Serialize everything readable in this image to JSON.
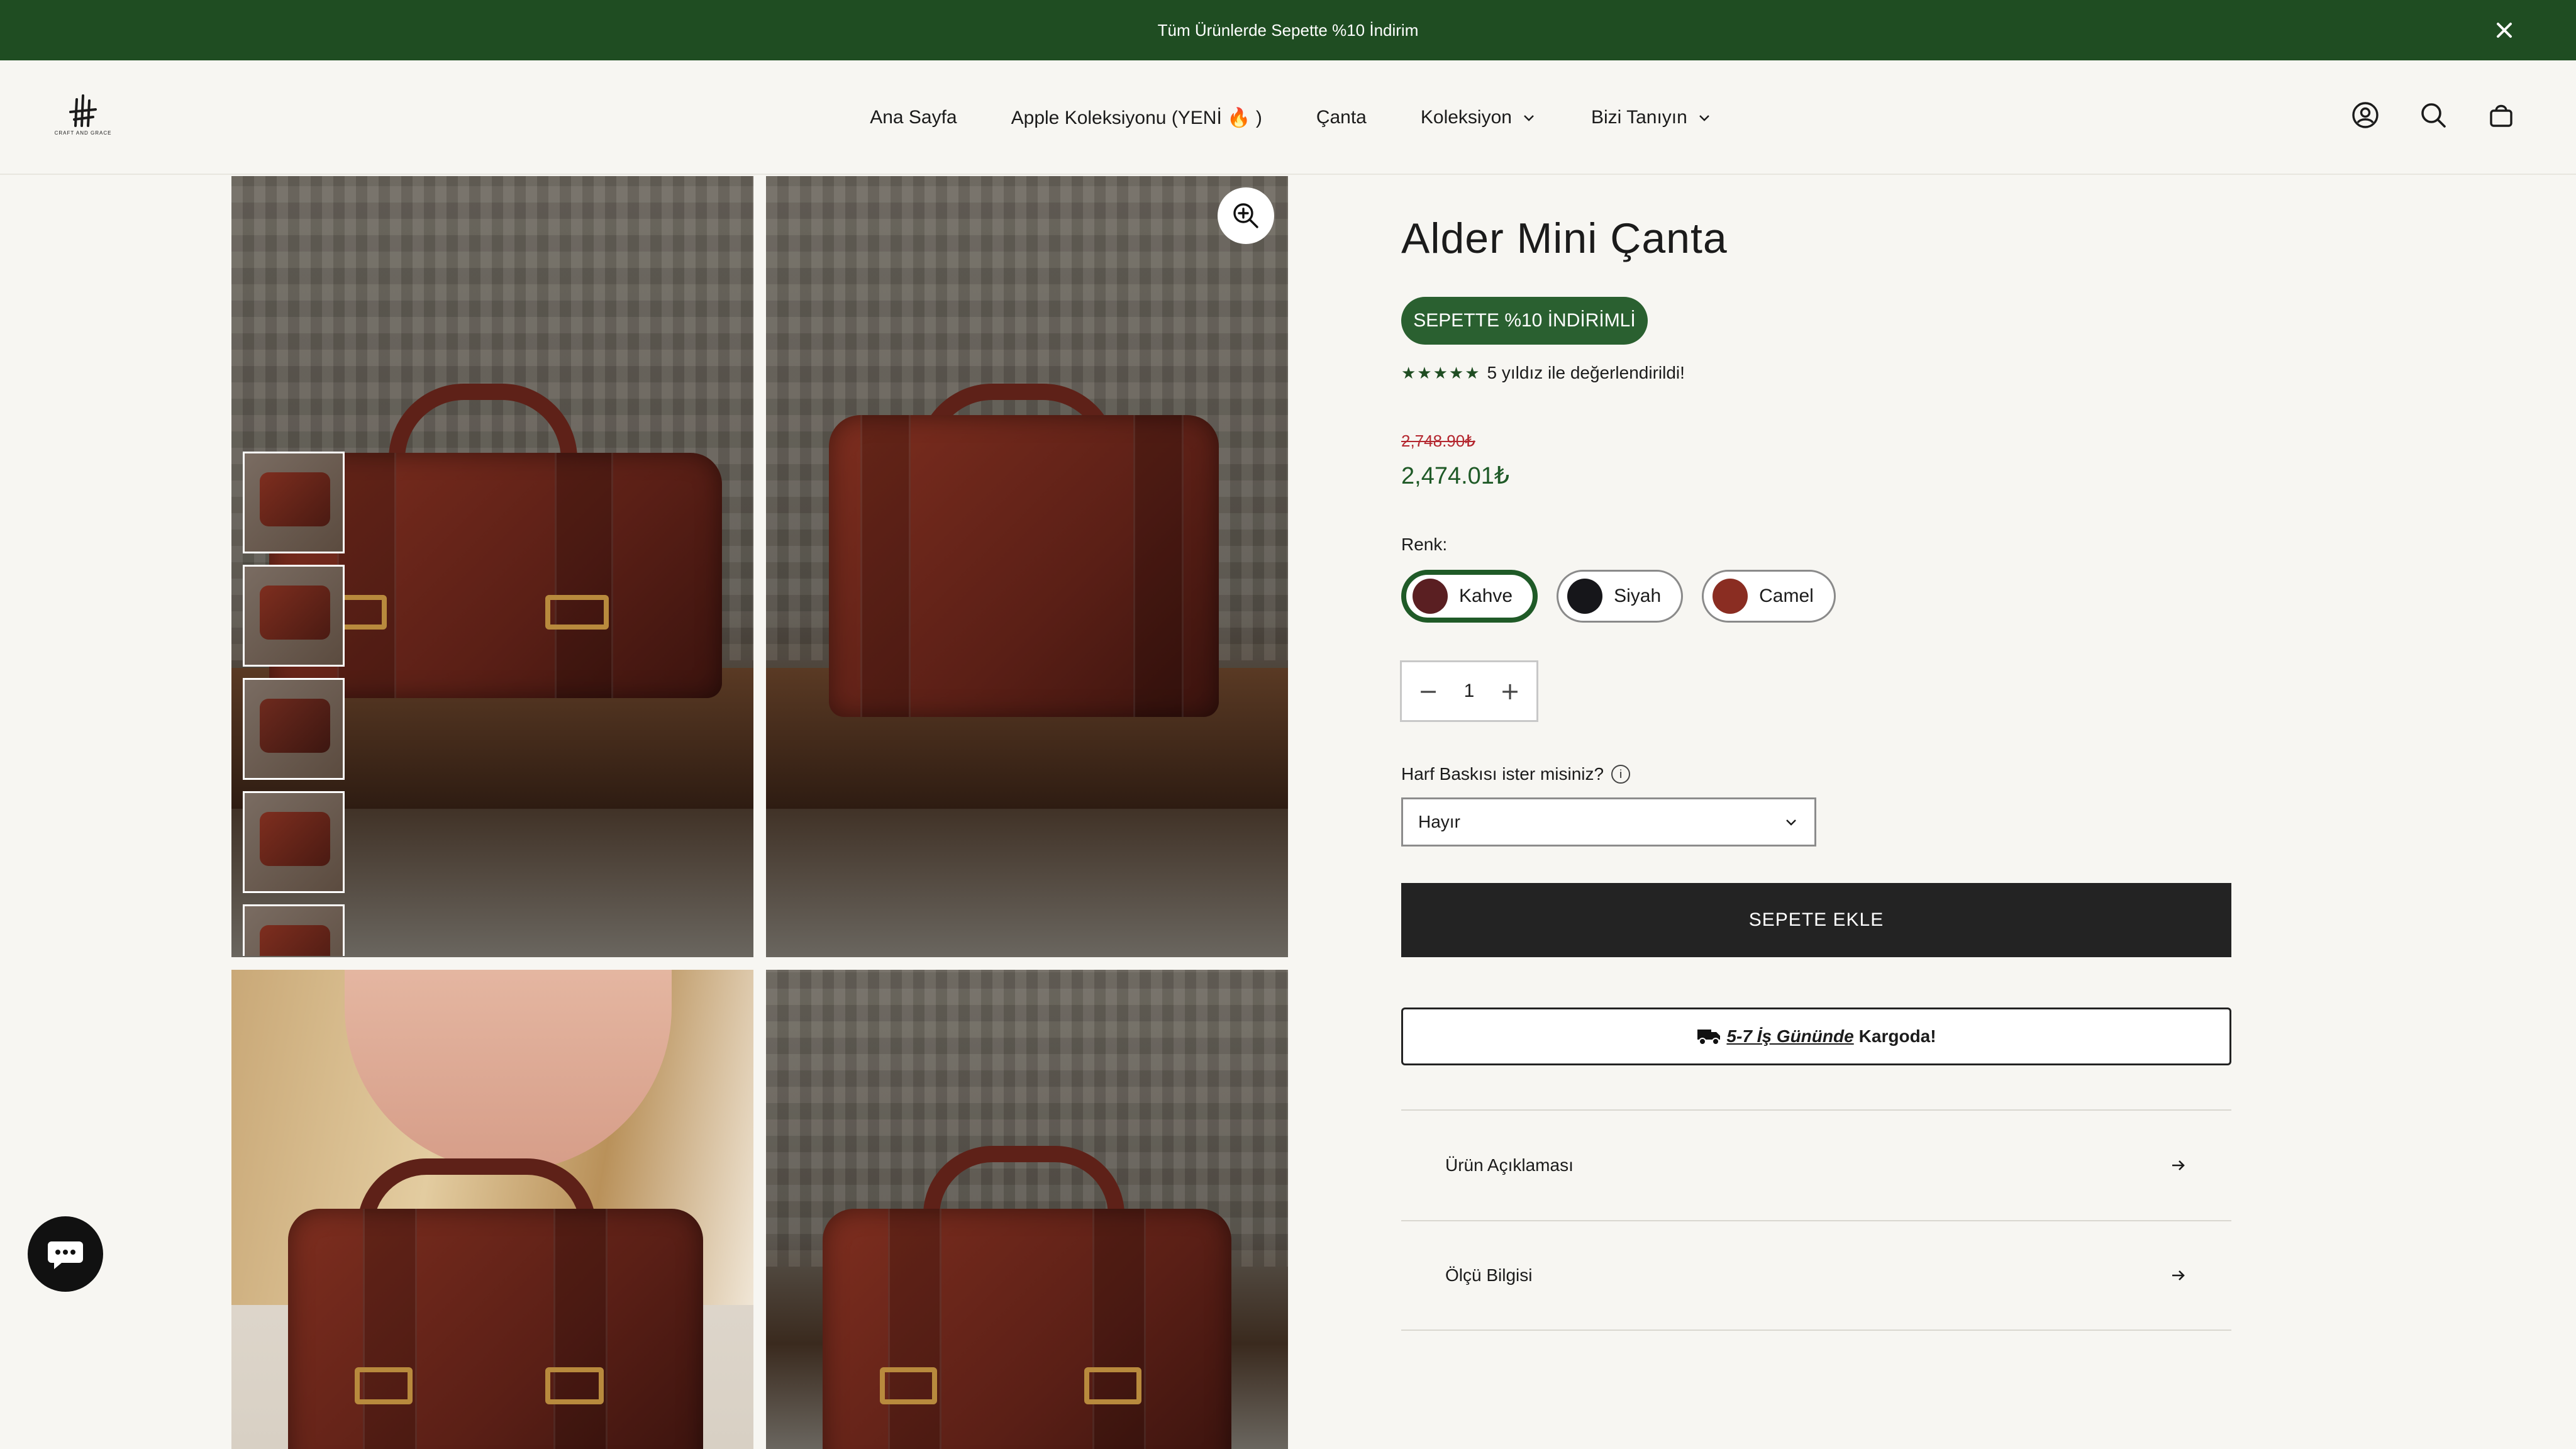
{
  "announcement": {
    "text": "Tüm Ürünlerde Sepette %10 İndirim"
  },
  "header": {
    "logo_text": "CRAFT AND GRACE",
    "nav": [
      {
        "label": "Ana Sayfa"
      },
      {
        "label": "Apple Koleksiyonu (YENİ 🔥 )"
      },
      {
        "label": "Çanta"
      },
      {
        "label": "Koleksiyon"
      },
      {
        "label": "Bizi Tanıyın"
      }
    ]
  },
  "product": {
    "title": "Alder Mini Çanta",
    "badge": "SEPETTE %10 İNDİRİMLİ",
    "stars": "★★★★★",
    "rating_text": "5 yıldız ile değerlendirildi!",
    "old_price": "2,748.90₺",
    "price": "2,474.01₺",
    "color_label": "Renk:",
    "colors": [
      {
        "name": "Kahve",
        "hex": "#5a1f22"
      },
      {
        "name": "Siyah",
        "hex": "#16161a"
      },
      {
        "name": "Camel",
        "hex": "#8a2d22"
      }
    ],
    "quantity": "1",
    "engraving_label": "Harf Baskısı ister misiniz?",
    "engraving_info": "i",
    "engraving_value": "Hayır",
    "add_to_cart": "SEPETE EKLE",
    "shipping_link": "5-7 İş Gününde",
    "shipping_text": "Kargoda!",
    "accordions": [
      {
        "label": "Ürün Açıklaması"
      },
      {
        "label": "Ölçü Bilgisi"
      }
    ]
  },
  "colors": {
    "announcement_bg": "#1f4d22",
    "accent_green": "#2a6030",
    "price_green": "#1f5a27",
    "old_price_red": "#b4272f",
    "button_dark": "#232323"
  }
}
